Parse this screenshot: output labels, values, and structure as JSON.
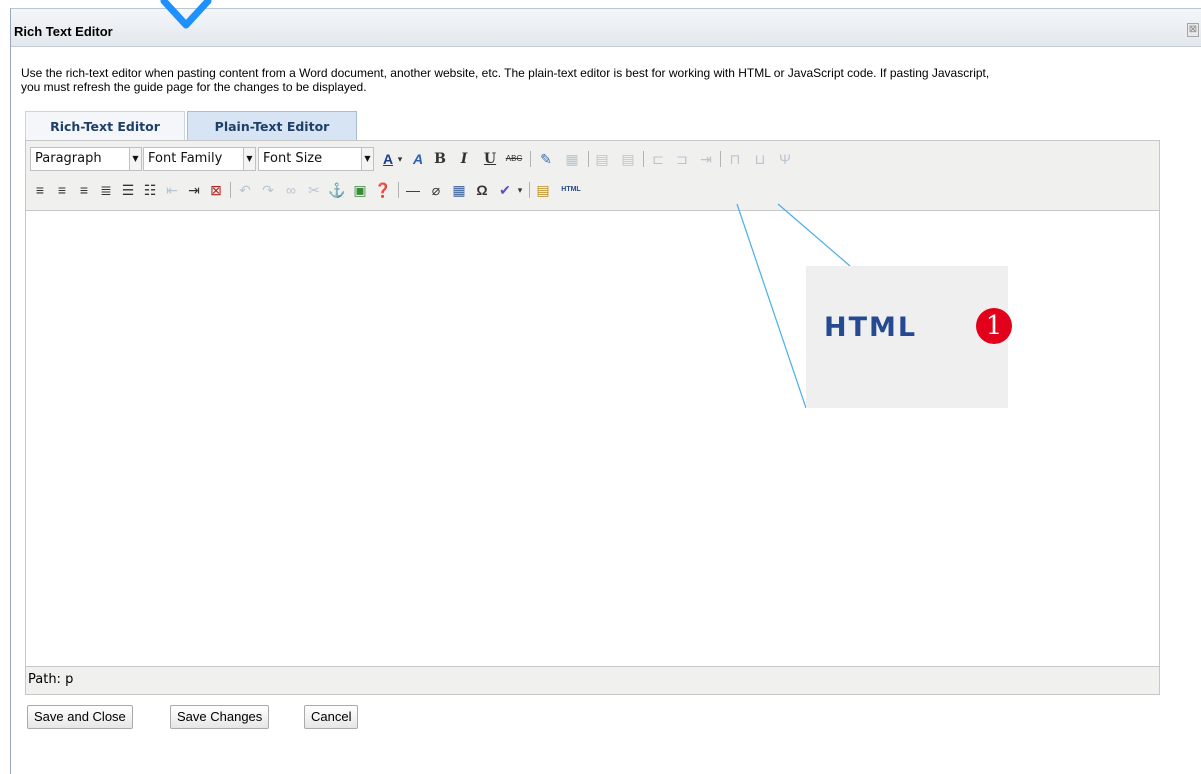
{
  "dialog": {
    "title": "Rich Text Editor",
    "close_glyph": "⊠",
    "intro_line1": "Use the rich-text editor when pasting content from a Word document, another website, etc. The plain-text editor is best for working with HTML or JavaScript code. If pasting Javascript,",
    "intro_line2": "you must refresh the guide page for the changes to be displayed."
  },
  "tabs": [
    {
      "label": "Rich-Text Editor",
      "active": false
    },
    {
      "label": "Plain-Text Editor",
      "active": true
    }
  ],
  "toolbar": {
    "format_select": "Paragraph",
    "font_family_select": "Font Family",
    "font_size_select": "Font Size",
    "html_button_label": "HTML",
    "icons_row1": [
      "font-color-icon",
      "highlight-color-icon",
      "bold-icon",
      "italic-icon",
      "underline-icon",
      "strikethrough-icon",
      "edit-icon",
      "table-props-icon",
      "row-insert-icon",
      "row-delete-icon",
      "col-insert-before-icon",
      "col-insert-after-icon",
      "col-delete-icon",
      "merge-cells-icon",
      "split-cells-icon",
      "split-cell-icon"
    ],
    "icons_row2": [
      "align-left-icon",
      "align-center-icon",
      "align-right-icon",
      "justify-icon",
      "bullet-list-icon",
      "numbered-list-icon",
      "outdent-icon",
      "indent-icon",
      "remove-format-icon",
      "undo-icon",
      "redo-icon",
      "link-icon",
      "unlink-icon",
      "anchor-icon",
      "image-icon",
      "help-icon",
      "hr-icon",
      "cleanup-icon",
      "table-icon",
      "special-char-icon",
      "spellcheck-icon",
      "paste-word-icon",
      "html-source-icon"
    ]
  },
  "editor": {
    "status_path": "Path: p"
  },
  "buttons": {
    "save_close": "Save and Close",
    "save_changes": "Save Changes",
    "cancel": "Cancel"
  },
  "callout": {
    "label": "HTML",
    "badge": "1",
    "badge_color": "#e3001b",
    "label_color": "#264a91"
  },
  "colors": {
    "accent_blue": "#1e90ff",
    "tab_active_bg": "#d7e4f4"
  }
}
